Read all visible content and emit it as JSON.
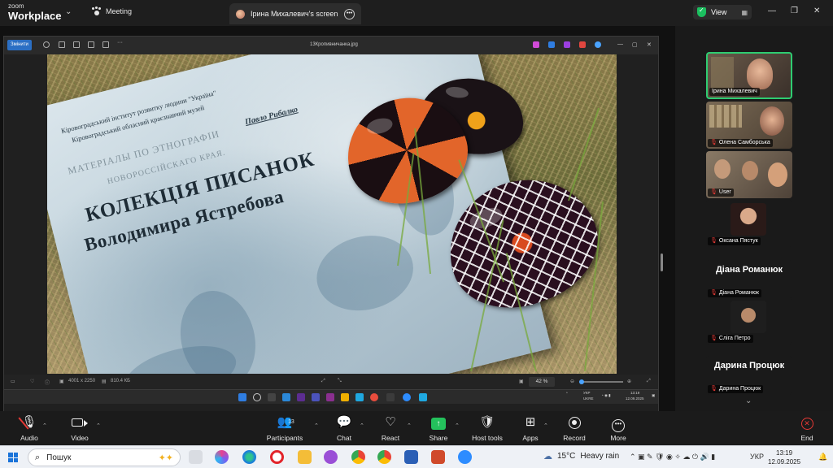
{
  "zoom": {
    "logo_line1": "zoom",
    "logo_line2": "Workplace",
    "meeting_tab": "Meeting",
    "share_tab": "Ірина Михалевич's screen",
    "view_label": "View"
  },
  "viewer": {
    "edit_button": "Змінити",
    "file_name": "13Кропивничанка.jpg",
    "dimensions": "4001 x 2250",
    "file_size": "810.4 КБ",
    "zoom_level": "42 %"
  },
  "photo": {
    "institute": "Кіровоградський інститут розвитку людини \"Україна\"",
    "museum": "Кіровоградський обласний краєзнавчий музей",
    "author": "Павло Рибалко",
    "old_text1": "МАТЕРІАЛЫ ПО ЭТНОГРАФІИ",
    "old_text2": "НОВОРОССІЙСКАГО КРАЯ.",
    "title1": "КОЛЕКЦІЯ ПИСАНОК",
    "title2": "Володимира Ястребова"
  },
  "remote_taskbar": {
    "lang": "УКР",
    "lang2": "UKRE",
    "time": "13:19",
    "date": "12.09.2025"
  },
  "gallery": {
    "tiles": [
      {
        "name": "Ірина Михалевич"
      },
      {
        "name": "Олена Самборська"
      },
      {
        "name": "User"
      },
      {
        "name": "Оксана Пястук"
      },
      {
        "big_name": "Діана Романюк",
        "name": "Діана Романюк"
      },
      {
        "name": "Сліга Петро"
      },
      {
        "big_name": "Дарина Процюк",
        "name": "Дарина Процюк"
      }
    ]
  },
  "toolbar": {
    "audio": "Audio",
    "video": "Video",
    "participants": "Participants",
    "participants_count": "13",
    "chat": "Chat",
    "react": "React",
    "share": "Share",
    "host_tools": "Host tools",
    "apps": "Apps",
    "record": "Record",
    "more": "More",
    "end": "End"
  },
  "windows": {
    "search_placeholder": "Пошук",
    "temperature": "15°C",
    "weather": "Heavy rain",
    "lang": "УКР",
    "time": "13:19",
    "date": "12.09.2025"
  }
}
